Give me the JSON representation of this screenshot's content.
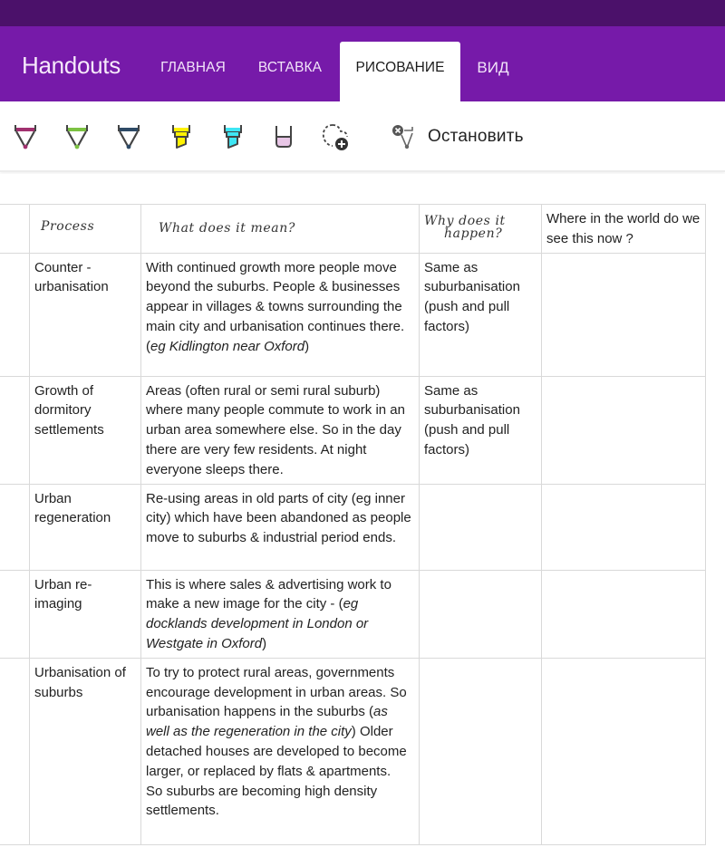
{
  "app": {
    "title": "Handouts",
    "colors": {
      "status_strip": "#4b116a",
      "ribbon": "#761aa9",
      "active_tab_bg": "#ffffff"
    }
  },
  "ribbon": {
    "tabs": [
      {
        "label": "ГЛАВНАЯ",
        "active": false
      },
      {
        "label": "ВСТАВКА",
        "active": false
      },
      {
        "label": "РИСОВАНИЕ",
        "active": true
      },
      {
        "label": "ВИД",
        "active": false
      }
    ]
  },
  "toolbar": {
    "tools": [
      {
        "name": "pen-magenta",
        "icon": "pen-icon",
        "color": "#a1306f"
      },
      {
        "name": "pen-green",
        "icon": "pen-icon",
        "color": "#7cc242"
      },
      {
        "name": "pen-navy",
        "icon": "pen-icon",
        "color": "#2e4a66"
      },
      {
        "name": "highlighter-yellow",
        "icon": "highlighter-icon",
        "color": "#fff200"
      },
      {
        "name": "highlighter-cyan",
        "icon": "highlighter-icon",
        "color": "#3ee6f4"
      },
      {
        "name": "eraser",
        "icon": "eraser-icon",
        "color": "#e8c6e6"
      },
      {
        "name": "lasso-select",
        "icon": "lasso-add-icon",
        "color": "#444444"
      }
    ],
    "stop_label": "Остановить"
  },
  "table": {
    "headers": {
      "process": "Process",
      "meaning": "What does it mean?",
      "why_line1": "Why does it",
      "why_line2": "happen?",
      "where": "Where in the world do we see this now ?"
    },
    "rows": [
      {
        "process": "Counter - urbanisation",
        "meaning": "With continued growth more people move beyond the suburbs. People & businesses appear in villages & towns surrounding the main city and urbanisation continues there.",
        "meaning_italic_prefix": "(",
        "meaning_italic": "eg Kidlington near Oxford",
        "meaning_italic_suffix": ")",
        "why": "Same as suburbanisation (push and pull factors)",
        "where": ""
      },
      {
        "process": "Growth of dormitory settlements",
        "meaning": "Areas (often rural or semi rural suburb) where many people commute to work in an urban area somewhere else. So in the day there are very few residents. At night everyone sleeps there.",
        "why": "Same as suburbanisation (push and pull factors)",
        "where": ""
      },
      {
        "process": "Urban regeneration",
        "meaning": "Re-using areas in old parts of city (eg inner city) which have been abandoned as people move to suburbs & industrial period ends.",
        "why": "",
        "where": ""
      },
      {
        "process": "Urban re-imaging",
        "meaning": "This is where sales & advertising work to make a new image for the city - (",
        "meaning_italic": "eg docklands development in London or Westgate in Oxford",
        "meaning_italic_suffix": ")",
        "why": "",
        "where": ""
      },
      {
        "process": "Urbanisation of suburbs",
        "meaning": "To try to protect rural areas, governments encourage development in urban areas. So urbanisation happens in the suburbs (",
        "meaning_italic": "as well as the regeneration in the city",
        "meaning_tail": ") Older detached houses are developed to become larger, or replaced by flats & apartments.",
        "meaning_line2": "So suburbs are becoming high density settlements.",
        "why": "",
        "where": ""
      }
    ]
  }
}
